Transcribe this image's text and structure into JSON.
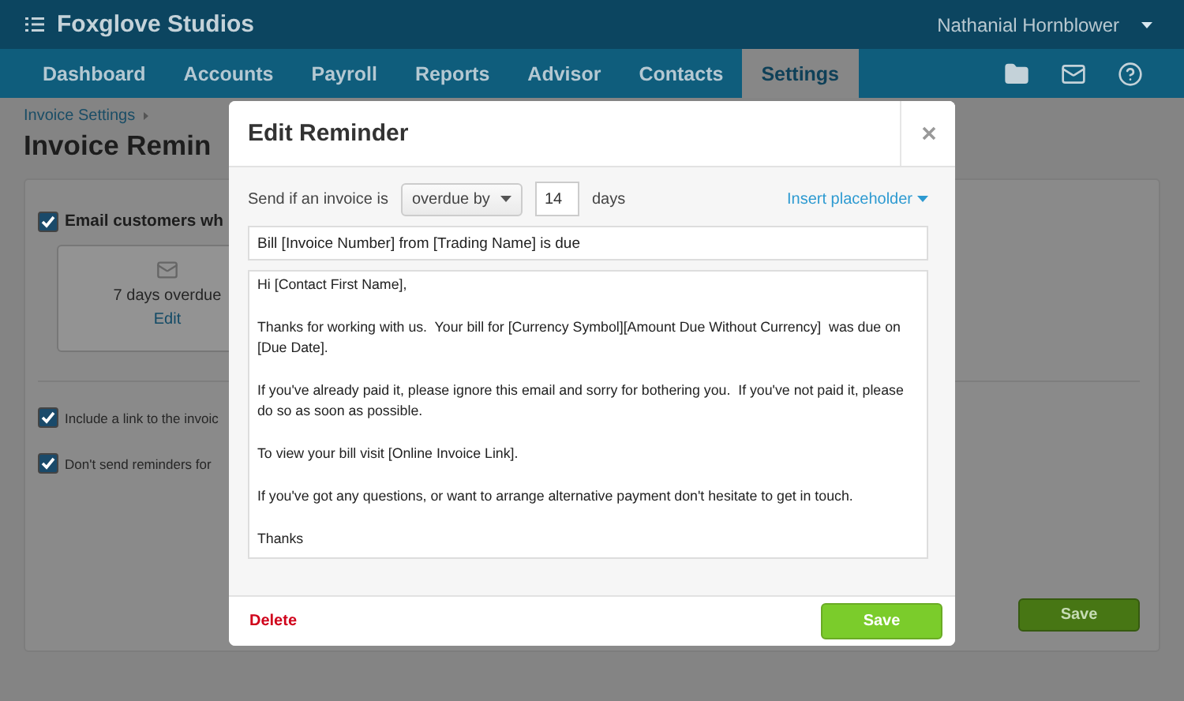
{
  "app": {
    "name": "Foxglove Studios",
    "user": "Nathanial Hornblower"
  },
  "nav": [
    {
      "label": "Dashboard",
      "selected": false
    },
    {
      "label": "Accounts",
      "selected": false
    },
    {
      "label": "Payroll",
      "selected": false
    },
    {
      "label": "Reports",
      "selected": false
    },
    {
      "label": "Advisor",
      "selected": false
    },
    {
      "label": "Contacts",
      "selected": false
    },
    {
      "label": "Settings",
      "selected": true
    }
  ],
  "page": {
    "breadcrumb": "Invoice Settings",
    "title": "Invoice Remin",
    "email_option": {
      "label": "Email customers wh",
      "checked": true
    },
    "reminder_card": {
      "label": "7 days overdue",
      "edit": "Edit"
    },
    "options": [
      {
        "label": "Include a link to the invoic",
        "checked": true
      },
      {
        "label": "Don't send reminders for",
        "checked": true
      }
    ],
    "save": "Save"
  },
  "dialog": {
    "title": "Edit Reminder",
    "send_label": "Send if an invoice is",
    "condition": "overdue by",
    "days_value": "14",
    "days_label": "days",
    "insert_placeholder": "Insert placeholder",
    "subject": "Bill [Invoice Number] from [Trading Name] is due",
    "message": [
      "Hi [Contact First Name],",
      "Thanks for working with us.  Your bill for [Currency Symbol][Amount Due Without Currency]  was due on [Due Date].",
      "If you've already paid it, please ignore this email and sorry for bothering you.  If you've not paid it, please do so as soon as possible.",
      "To view your bill visit [Online Invoice Link].",
      "If you've got any questions, or want to arrange alternative payment don't hesitate to get in touch.",
      "Thanks"
    ],
    "delete": "Delete",
    "save": "Save"
  }
}
